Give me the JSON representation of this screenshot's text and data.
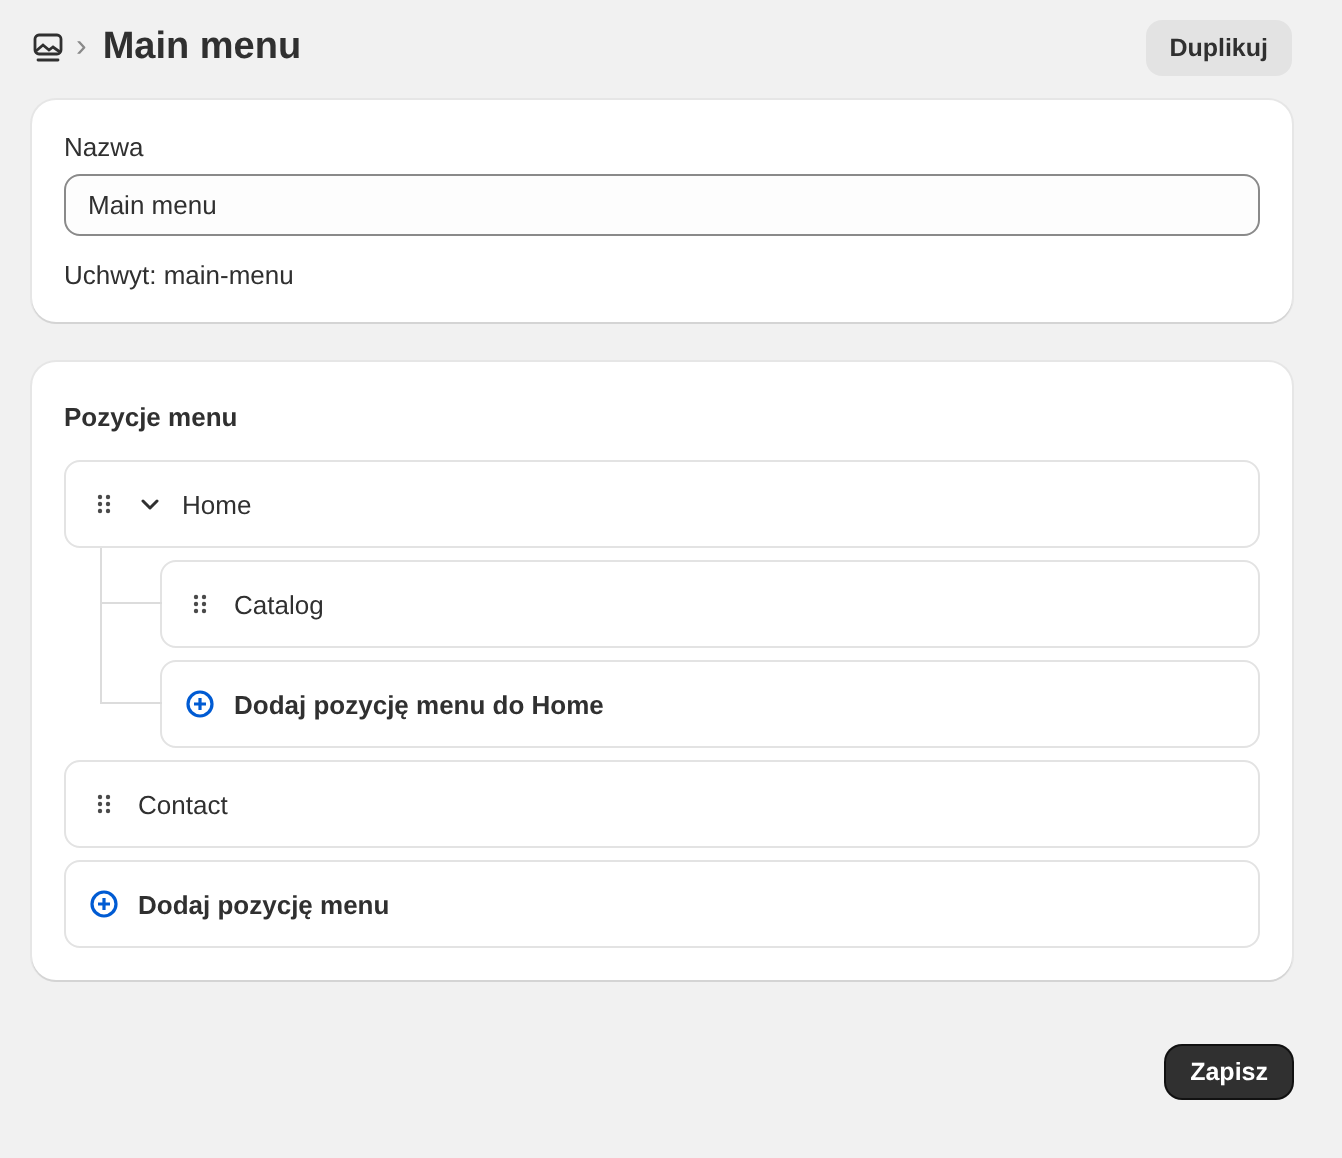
{
  "breadcrumb": {
    "separator": "›",
    "title": "Main menu"
  },
  "header_button": "Duplikuj",
  "name_card": {
    "label": "Nazwa",
    "value": "Main menu",
    "handle": "Uchwyt: main-menu"
  },
  "menu_card": {
    "title": "Pozycje menu",
    "items": [
      {
        "kind": "link",
        "label": "Home",
        "expanded": true,
        "children": [
          {
            "kind": "link",
            "label": "Catalog"
          },
          {
            "kind": "add",
            "label": "Dodaj pozycję menu do Home"
          }
        ]
      },
      {
        "kind": "link",
        "label": "Contact"
      },
      {
        "kind": "add",
        "label": "Dodaj pozycję menu"
      }
    ]
  },
  "save_button": "Zapisz"
}
